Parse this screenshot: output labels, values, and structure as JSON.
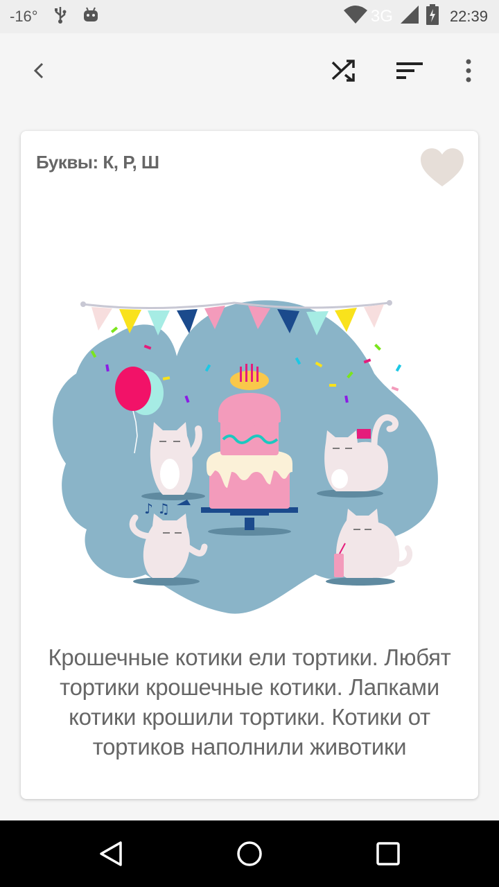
{
  "status_bar": {
    "temperature": "-16°",
    "network": "3G",
    "time": "22:39",
    "icons": [
      "usb-icon",
      "android-icon",
      "wifi-icon",
      "signal-icon",
      "battery-charging-icon"
    ]
  },
  "app_bar": {
    "icons": [
      "back-icon",
      "shuffle-icon",
      "sort-icon",
      "more-vert-icon"
    ]
  },
  "card": {
    "letters_label": "Буквы: К, Р, Ш",
    "favorite_icon": "heart-icon",
    "favorite_color": "#e6ded8",
    "illustration": "cats-party-illustration",
    "text": "Крошечные котики ели тортики. Любят тортики крошечные котики. Лапками котики крошили тортики. Котики от тортиков наполнили животики"
  },
  "nav_bar": {
    "icons": [
      "nav-back-icon",
      "nav-home-icon",
      "nav-recents-icon"
    ]
  },
  "colors": {
    "background": "#f5f5f5",
    "card": "#ffffff",
    "text": "#666666",
    "blob": "#8ab4c8"
  }
}
